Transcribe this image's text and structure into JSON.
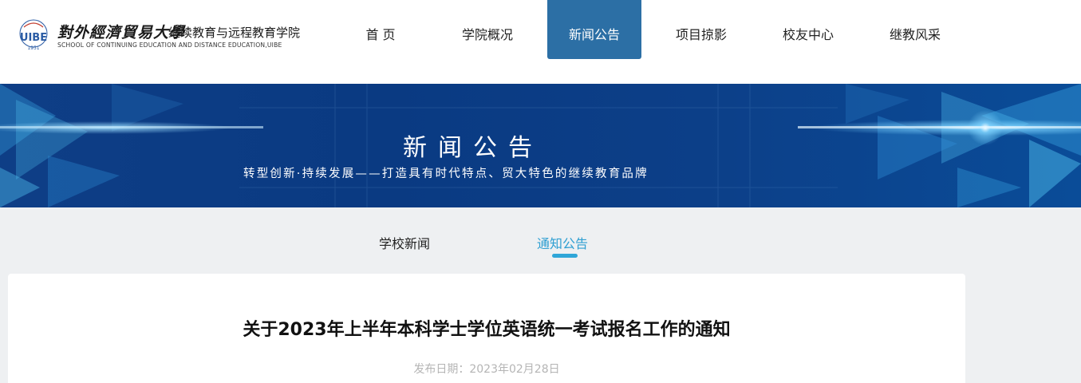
{
  "logo": {
    "cn_script": "對外經濟貿易大學",
    "cn_name": "继续教育与远程教育学院",
    "en_name": "SCHOOL OF CONTINUING EDUCATION AND DISTANCE EDUCATION,UIBE",
    "emblem_text": "UIBE",
    "emblem_year": "1951"
  },
  "nav": [
    {
      "label": "首 页",
      "active": false
    },
    {
      "label": "学院概况",
      "active": false
    },
    {
      "label": "新闻公告",
      "active": true
    },
    {
      "label": "项目掠影",
      "active": false
    },
    {
      "label": "校友中心",
      "active": false
    },
    {
      "label": "继教风采",
      "active": false
    }
  ],
  "banner": {
    "title": "新闻公告",
    "subtitle": "转型创新·持续发展——打造具有时代特点、贸大特色的继续教育品牌"
  },
  "tabs": [
    {
      "label": "学校新闻",
      "active": false
    },
    {
      "label": "通知公告",
      "active": true
    }
  ],
  "article": {
    "title": "关于2023年上半年本科学士学位英语统一考试报名工作的通知",
    "date": "发布日期：2023年02月28日"
  },
  "colors": {
    "nav_active": "#2c6fa5",
    "tab_active": "#2f9fd2",
    "banner_bg": "#0c3f88",
    "page_bg": "#eef0f2"
  }
}
